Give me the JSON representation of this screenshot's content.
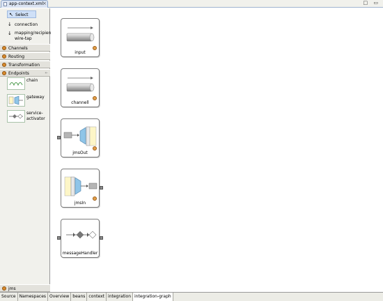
{
  "editor": {
    "tab_title": "app-context.xml",
    "close_glyph": "×",
    "window_controls": "□ ▭"
  },
  "palette": {
    "select_label": "Select",
    "tools": [
      {
        "label": "connection",
        "icon": "arrow-down-icon"
      },
      {
        "label": "mapping/recipient/ wire-tap",
        "icon": "arrow-down-icon"
      }
    ],
    "drawers": [
      {
        "label": "Channels"
      },
      {
        "label": "Routing"
      },
      {
        "label": "Transformation"
      },
      {
        "label": "Endpoints",
        "pin": "⇤"
      },
      {
        "label": "jms"
      }
    ],
    "endpoint_tools": [
      {
        "label": "chain",
        "icon": "chain-icon"
      },
      {
        "label": "gateway",
        "icon": "gateway-icon"
      },
      {
        "label": "service-activator",
        "icon": "service-activator-icon"
      }
    ]
  },
  "canvas": {
    "nodes": [
      {
        "label": "input",
        "kind": "channel"
      },
      {
        "label": "channell",
        "kind": "channel"
      },
      {
        "label": "jmsOut",
        "kind": "outbound-adapter"
      },
      {
        "label": "jmsIn",
        "kind": "inbound-adapter"
      },
      {
        "label": "messageHandler",
        "kind": "service-activator"
      }
    ]
  },
  "bottom_tabs": [
    {
      "label": "Source"
    },
    {
      "label": "Namespaces"
    },
    {
      "label": "Overview"
    },
    {
      "label": "beans"
    },
    {
      "label": "context"
    },
    {
      "label": "integration"
    },
    {
      "label": "integration-graph",
      "active": true
    }
  ],
  "colors": {
    "selection": "#cfe0f7",
    "drawer_icon": "#d88a2c",
    "adapter_blue": "#8fc5e8",
    "adapter_yellow": "#fdf6c7"
  }
}
